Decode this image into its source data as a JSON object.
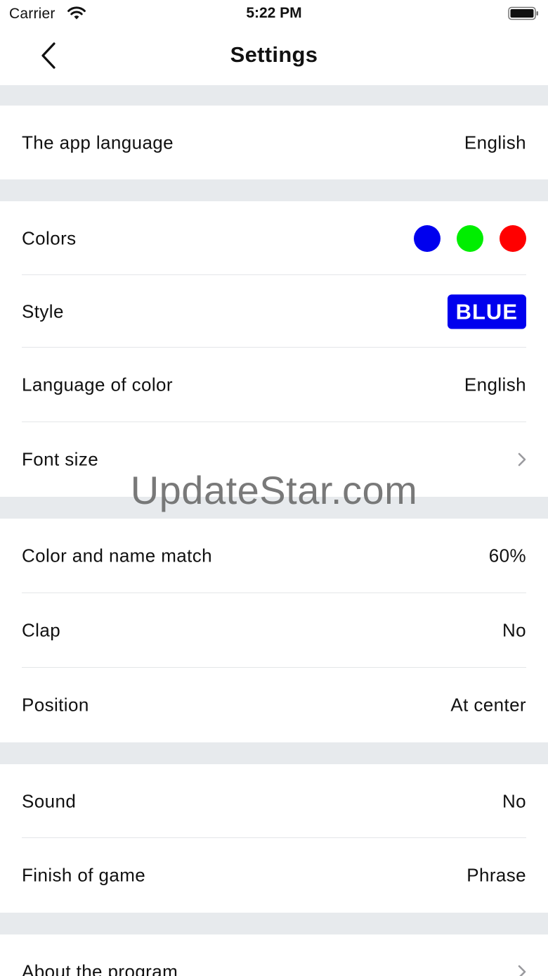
{
  "status_bar": {
    "carrier": "Carrier",
    "time": "5:22 PM"
  },
  "nav": {
    "title": "Settings"
  },
  "rows": {
    "app_language": {
      "label": "The app language",
      "value": "English"
    },
    "colors": {
      "label": "Colors",
      "dots": [
        "#0000ee",
        "#00ee00",
        "#ff0000"
      ]
    },
    "style": {
      "label": "Style",
      "badge": "BLUE",
      "badge_color": "#0000ee"
    },
    "language_of_color": {
      "label": "Language of color",
      "value": "English"
    },
    "font_size": {
      "label": "Font size"
    },
    "color_name_match": {
      "label": "Color and name match",
      "value": "60%"
    },
    "clap": {
      "label": "Clap",
      "value": "No"
    },
    "position": {
      "label": "Position",
      "value": "At center"
    },
    "sound": {
      "label": "Sound",
      "value": "No"
    },
    "finish_of_game": {
      "label": "Finish of game",
      "value": "Phrase"
    },
    "about": {
      "label": "About the program"
    }
  },
  "watermark": "UpdateStar.com",
  "colors": {
    "separator_bg": "#e7eaed",
    "text": "#111111"
  }
}
